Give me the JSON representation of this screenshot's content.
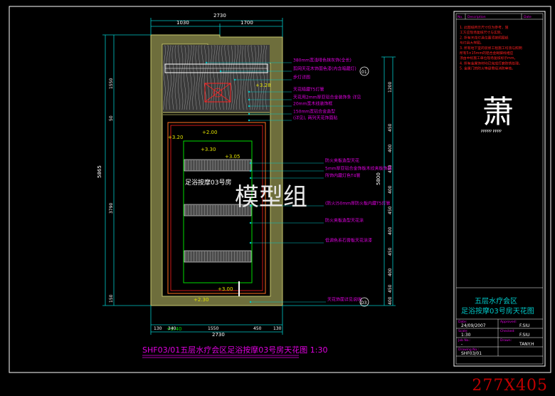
{
  "drawing": {
    "title": "SHF03/01五层水疗会区足浴按摩03号房天花图 1:30",
    "room_label": "足浴按摩03号房",
    "watermark": "模型组",
    "scale_stamp": "277X405"
  },
  "dimensions": {
    "top_total": "2730",
    "top_left": "1030",
    "top_right": "1700",
    "bottom_total": "2730",
    "bottom_parts": [
      "130",
      "340",
      "1550",
      "450",
      "130"
    ],
    "left_total": "5865",
    "left_parts": [
      "1550",
      "50",
      "3790",
      "150"
    ],
    "right_total": "5800",
    "right_parts": [
      "1200",
      "450",
      "400",
      "450",
      "400",
      "450",
      "400",
      "450",
      "400",
      "450",
      "400"
    ]
  },
  "levels": {
    "top_ceiling": "+3.20",
    "main_ceiling": "+3.28",
    "inner_ceiling_a": "+3.30",
    "inner_ceiling_b": "+3.05",
    "perimeter": "+2.00",
    "lower_level": "+3.00",
    "bottom_level": "+2.30",
    "strip_level": "+2.40"
  },
  "annotations": [
    "380mm宽浅啡色抹灰饰(全长)",
    "剪网天花木饰面色漆(内含暗藏灯)",
    "步灯详图",
    "天花暗藏T5灯管",
    "天花用2mm厚亚铝合金装饰条 详见",
    "20mm宽木线装饰框",
    "150mm宽铝合金造型",
    "(详见), 两列天花饰面贴",
    "防火夹板造型天花",
    "5mm厚亚铝合金饰板木纹夹板饰面",
    "所饰内藏灯色T4管",
    "(防火)50mm厚防火板内藏T5灯管",
    "防火夹板造型天花涂",
    "低调色系石膏板天花涂漆",
    "天花饰面详见说明"
  ],
  "callout": {
    "label": "01",
    "ref": "D3"
  },
  "title_block": {
    "header_cols": [
      "No.",
      "Description",
      "Date"
    ],
    "notes": [
      "1. 此图纸所示尺寸仅为参考，施",
      "工方应现场复核尺寸与实际。",
      "2. 所有天花灯具位置须按照图纸",
      "与灯具大样图。",
      "3. 所有地下室的装修工程施工均须与照明",
      "所有5×15mm的铝合金踢脚线相应",
      "须由中标施工单位现场复核标示mm。",
      "4. 所有金属饰材均已完成打磨防锈处理。",
      "5. 金属门的防火等级需经消防审核。"
    ],
    "logo_char": "萧",
    "logo_sub": "PPPPP PPPP",
    "project_name": "五层水疗会区",
    "sheet_name": "足浴按摩03号房天花图",
    "rows": [
      {
        "label": "Date:",
        "value": "24/09/2007",
        "label2": "Approved:",
        "value2": "F.SIU"
      },
      {
        "label": "Scale:",
        "value": "1:30",
        "label2": "Checked:",
        "value2": "F.SIU"
      },
      {
        "label": "Job No.:",
        "value": "-",
        "label2": "Drawn:",
        "value2": "TANY.H"
      },
      {
        "label": "Drawing No.:",
        "value": "SHF03/01",
        "label2": "",
        "value2": ""
      }
    ]
  },
  "colors": {
    "background": "#000000",
    "outline_gold": "#c8c86e",
    "wall_fill": "#6e6e3c",
    "magenta": "#e000e0",
    "cyan": "#00c8c8",
    "green": "#00dc00",
    "yellow": "#e0e000",
    "red": "#ff2020",
    "white": "#ffffff",
    "stamp_red": "#c00000"
  }
}
